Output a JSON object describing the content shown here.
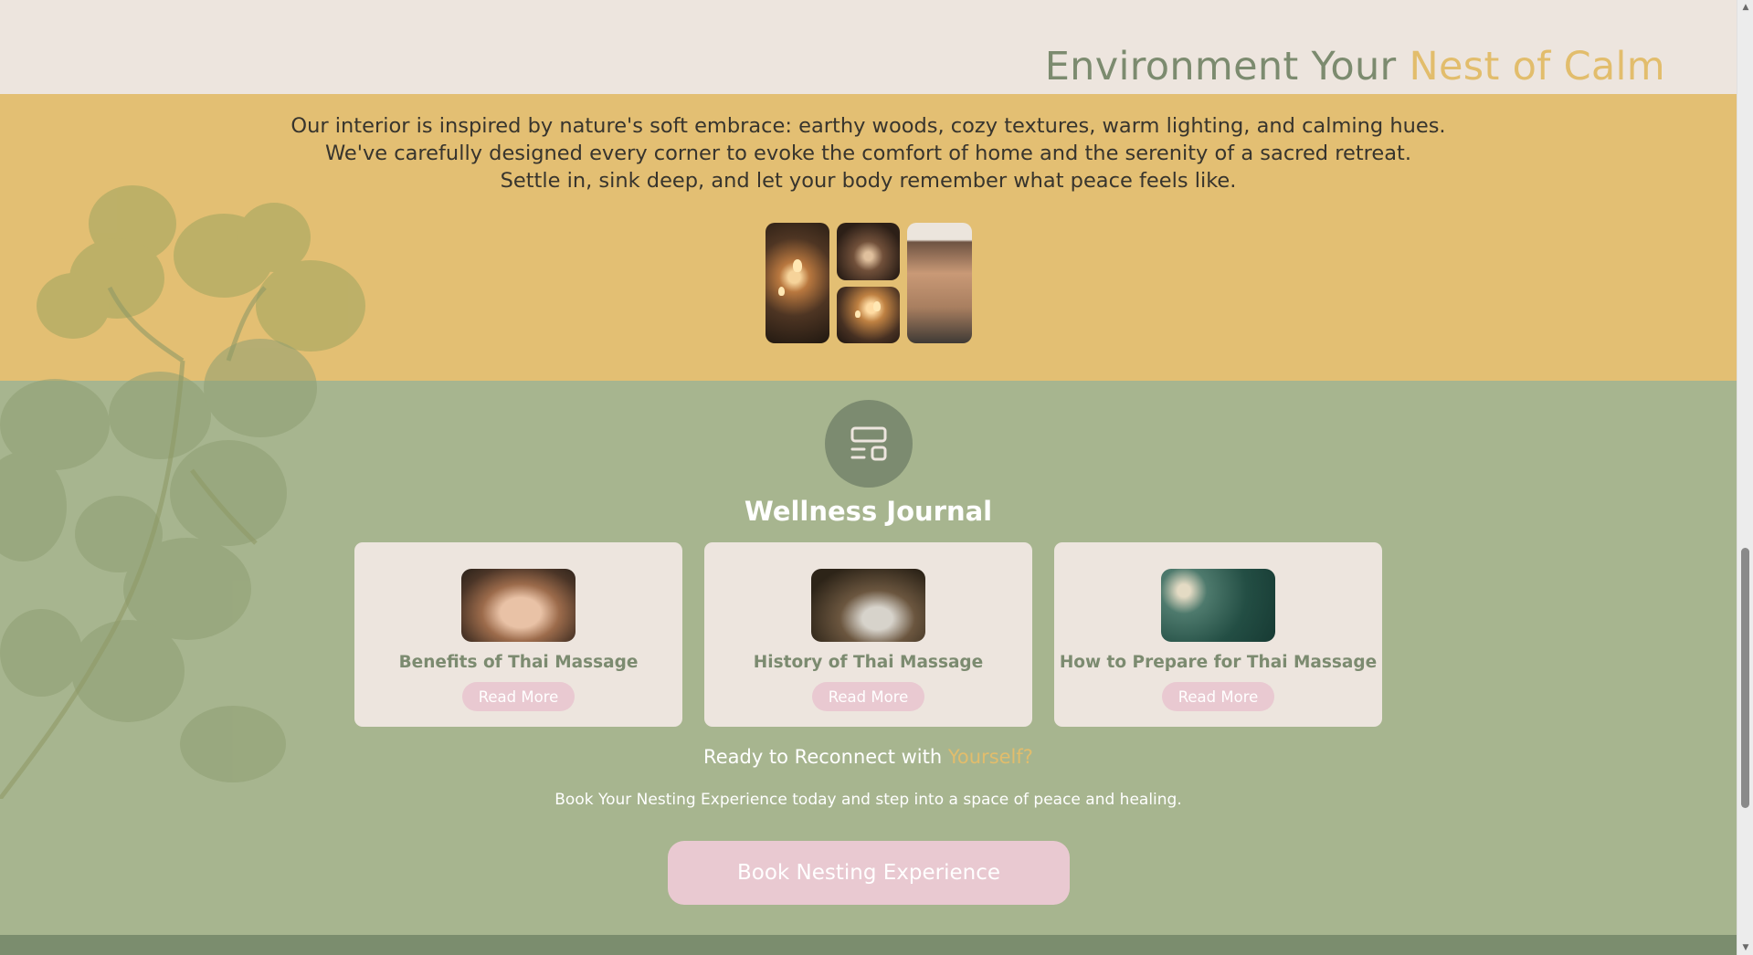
{
  "environment": {
    "title_main": "Environment Your ",
    "title_accent": "Nest of Calm"
  },
  "intro": {
    "line1": "Our interior is inspired by nature's soft embrace: earthy woods, cozy textures, warm lighting, and calming hues.",
    "line2": "We've carefully designed every corner to evoke the comfort of home and the serenity of a sacred retreat.",
    "line3": "Settle in, sink deep, and let your body remember what peace feels like."
  },
  "journal": {
    "icon": "layout-icon",
    "title": "Wellness Journal",
    "cards": [
      {
        "title": "Benefits of Thai Massage",
        "button": "Read More"
      },
      {
        "title": "History of Thai Massage",
        "button": "Read More"
      },
      {
        "title": "How to Prepare for Thai Massage",
        "button": "Read More"
      }
    ]
  },
  "cta": {
    "heading_main": "Ready to Reconnect with ",
    "heading_accent": "Yourself?",
    "subtext": "Book Your Nesting Experience today and step into a space of peace and healing.",
    "button": "Book Nesting Experience"
  },
  "colors": {
    "cream": "#ede5de",
    "yellow": "#e3bf73",
    "sage": "#a7b58f",
    "dark_sage": "#7c8b70",
    "pink": "#e9c9d1",
    "gold_accent": "#e2bd6c"
  },
  "scrollbar": {
    "up_icon": "▲",
    "down_icon": "▼"
  }
}
